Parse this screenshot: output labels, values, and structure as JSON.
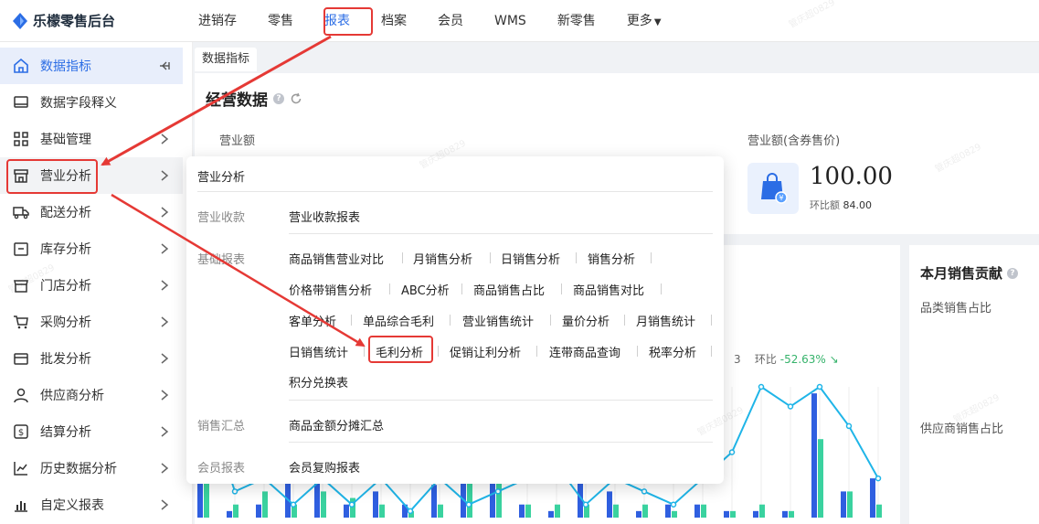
{
  "app": {
    "title": "乐檬零售后台"
  },
  "nav": [
    {
      "label": "进销存"
    },
    {
      "label": "零售"
    },
    {
      "label": "报表",
      "active": true
    },
    {
      "label": "档案"
    },
    {
      "label": "会员"
    },
    {
      "label": "WMS"
    },
    {
      "label": "新零售"
    },
    {
      "label": "更多"
    }
  ],
  "sidebar": {
    "items": [
      {
        "label": "数据指标",
        "icon": "home-icon",
        "active": true
      },
      {
        "label": "数据字段释义",
        "icon": "monitor-icon"
      },
      {
        "label": "基础管理",
        "icon": "grid-icon"
      },
      {
        "label": "营业分析",
        "icon": "store-icon",
        "hover": true
      },
      {
        "label": "配送分析",
        "icon": "truck-icon"
      },
      {
        "label": "库存分析",
        "icon": "inventory-icon"
      },
      {
        "label": "门店分析",
        "icon": "shop-icon"
      },
      {
        "label": "采购分析",
        "icon": "cart-icon"
      },
      {
        "label": "批发分析",
        "icon": "wallet-icon"
      },
      {
        "label": "供应商分析",
        "icon": "user-icon"
      },
      {
        "label": "结算分析",
        "icon": "dollar-icon"
      },
      {
        "label": "历史数据分析",
        "icon": "line-chart-icon"
      },
      {
        "label": "自定义报表",
        "icon": "bar-chart-icon"
      }
    ]
  },
  "tabs": [
    {
      "label": "数据指标"
    }
  ],
  "main": {
    "section_title": "经营数据",
    "metric1_label": "营业额",
    "metric2_label": "营业额(含券售价)",
    "metric2_value": "100.00",
    "metric2_compare_label": "环比额",
    "metric2_compare_value": "84.00",
    "mom_label": "环比",
    "mom_value": "-52.63%",
    "mom_digit": "3"
  },
  "right": {
    "title": "本月销售贡献",
    "sub1": "品类销售占比",
    "sub2": "供应商销售占比"
  },
  "flyout": {
    "title": "营业分析",
    "groups": [
      {
        "category": "营业收款",
        "links": [
          "营业收款报表"
        ]
      },
      {
        "category": "基础报表",
        "links": [
          "商品销售营业对比",
          "月销售分析",
          "日销售分析",
          "销售分析",
          "价格带销售分析",
          "ABC分析",
          "商品销售占比",
          "商品销售对比",
          "客单分析",
          "单品综合毛利",
          "营业销售统计",
          "量价分析",
          "月销售统计",
          "日销售统计",
          "毛利分析",
          "促销让利分析",
          "连带商品查询",
          "税率分析",
          "积分兑换表"
        ]
      },
      {
        "category": "销售汇总",
        "links": [
          "商品金额分摊汇总"
        ]
      },
      {
        "category": "会员报表",
        "links": [
          "会员复购报表"
        ]
      }
    ]
  },
  "watermark": "管庆超0829",
  "colors": {
    "accent": "#2b6de5",
    "highlight": "#e53935",
    "bar_blue": "#2f5fe0",
    "bar_green": "#3ad29f",
    "line": "#1fb5e8"
  },
  "chart_data": {
    "type": "bar",
    "series": [
      {
        "values": [
          0.5,
          0.05,
          0.1,
          0.4,
          0.3,
          0.1,
          0.2,
          0.1,
          0.25,
          0.65,
          0.6,
          0.1,
          0.05,
          0.3,
          0.2,
          0.05,
          0.1,
          0.1,
          0.05,
          0.05,
          0.05,
          0.95,
          0.2,
          0.3
        ]
      },
      {
        "values": [
          0.7,
          0.1,
          0.2,
          0.1,
          0.2,
          0.15,
          0.1,
          0.05,
          0.1,
          0.6,
          0.3,
          0.1,
          0.1,
          0.1,
          0.1,
          0.1,
          0.05,
          0.1,
          0.05,
          0.1,
          0.05,
          0.6,
          0.2,
          0.1
        ]
      },
      {
        "values": [
          0.9,
          0.2,
          0.3,
          0.1,
          0.3,
          0.1,
          0.3,
          0.05,
          0.3,
          0.1,
          0.2,
          0.3,
          0.4,
          0.1,
          0.3,
          0.2,
          0.1,
          0.3,
          0.5,
          1.0,
          0.85,
          1.0,
          0.7,
          0.3
        ]
      }
    ]
  }
}
